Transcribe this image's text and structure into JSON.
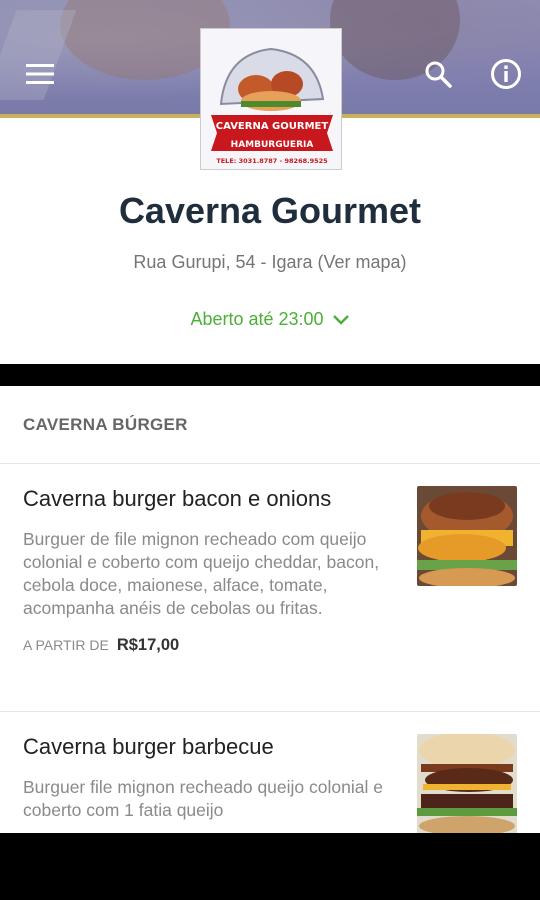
{
  "app": {
    "logo": {
      "line1": "CAVERNA GOURMET",
      "line2": "HAMBURGUERIA",
      "line3": "TELE: 3031.8787 - 98268.9525"
    }
  },
  "header": {
    "icons": [
      "menu-icon",
      "search-icon",
      "info-icon"
    ],
    "banner_accent": "#c9b25a"
  },
  "store": {
    "name": "Caverna Gourmet",
    "address": "Rua Gurupi, 54 - Igara (Ver mapa)",
    "hours": "Aberto até 23:00",
    "hours_color": "#4caf37"
  },
  "menu": {
    "section_title": "CAVERNA BÚRGER",
    "items": [
      {
        "name": "Caverna burger bacon e onions",
        "description": "Burguer de file mignon recheado com queijo colonial e coberto com queijo cheddar, bacon, cebola doce, maionese, alface, tomate, acompanha anéis de cebolas ou fritas.",
        "price_prefix": "A PARTIR DE",
        "price": "R$17,00"
      },
      {
        "name": "Caverna burger barbecue",
        "description": "Burguer file mignon recheado queijo colonial e coberto com 1 fatia queijo"
      }
    ]
  }
}
